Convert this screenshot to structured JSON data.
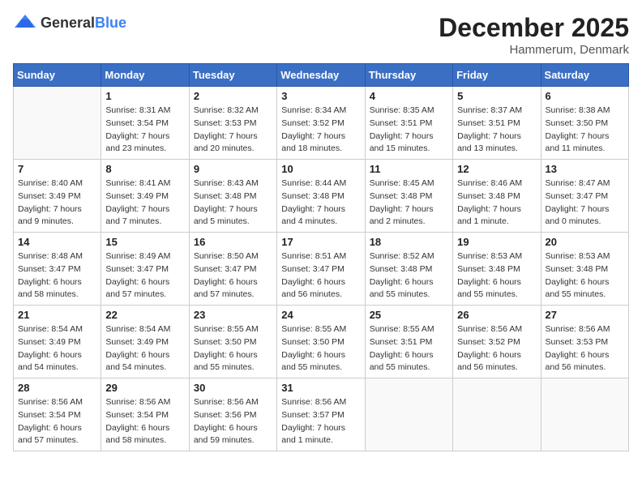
{
  "header": {
    "logo_general": "General",
    "logo_blue": "Blue",
    "month_year": "December 2025",
    "location": "Hammerum, Denmark"
  },
  "weekdays": [
    "Sunday",
    "Monday",
    "Tuesday",
    "Wednesday",
    "Thursday",
    "Friday",
    "Saturday"
  ],
  "weeks": [
    [
      {
        "day": "",
        "info": ""
      },
      {
        "day": "1",
        "info": "Sunrise: 8:31 AM\nSunset: 3:54 PM\nDaylight: 7 hours\nand 23 minutes."
      },
      {
        "day": "2",
        "info": "Sunrise: 8:32 AM\nSunset: 3:53 PM\nDaylight: 7 hours\nand 20 minutes."
      },
      {
        "day": "3",
        "info": "Sunrise: 8:34 AM\nSunset: 3:52 PM\nDaylight: 7 hours\nand 18 minutes."
      },
      {
        "day": "4",
        "info": "Sunrise: 8:35 AM\nSunset: 3:51 PM\nDaylight: 7 hours\nand 15 minutes."
      },
      {
        "day": "5",
        "info": "Sunrise: 8:37 AM\nSunset: 3:51 PM\nDaylight: 7 hours\nand 13 minutes."
      },
      {
        "day": "6",
        "info": "Sunrise: 8:38 AM\nSunset: 3:50 PM\nDaylight: 7 hours\nand 11 minutes."
      }
    ],
    [
      {
        "day": "7",
        "info": "Sunrise: 8:40 AM\nSunset: 3:49 PM\nDaylight: 7 hours\nand 9 minutes."
      },
      {
        "day": "8",
        "info": "Sunrise: 8:41 AM\nSunset: 3:49 PM\nDaylight: 7 hours\nand 7 minutes."
      },
      {
        "day": "9",
        "info": "Sunrise: 8:43 AM\nSunset: 3:48 PM\nDaylight: 7 hours\nand 5 minutes."
      },
      {
        "day": "10",
        "info": "Sunrise: 8:44 AM\nSunset: 3:48 PM\nDaylight: 7 hours\nand 4 minutes."
      },
      {
        "day": "11",
        "info": "Sunrise: 8:45 AM\nSunset: 3:48 PM\nDaylight: 7 hours\nand 2 minutes."
      },
      {
        "day": "12",
        "info": "Sunrise: 8:46 AM\nSunset: 3:48 PM\nDaylight: 7 hours\nand 1 minute."
      },
      {
        "day": "13",
        "info": "Sunrise: 8:47 AM\nSunset: 3:47 PM\nDaylight: 7 hours\nand 0 minutes."
      }
    ],
    [
      {
        "day": "14",
        "info": "Sunrise: 8:48 AM\nSunset: 3:47 PM\nDaylight: 6 hours\nand 58 minutes."
      },
      {
        "day": "15",
        "info": "Sunrise: 8:49 AM\nSunset: 3:47 PM\nDaylight: 6 hours\nand 57 minutes."
      },
      {
        "day": "16",
        "info": "Sunrise: 8:50 AM\nSunset: 3:47 PM\nDaylight: 6 hours\nand 57 minutes."
      },
      {
        "day": "17",
        "info": "Sunrise: 8:51 AM\nSunset: 3:47 PM\nDaylight: 6 hours\nand 56 minutes."
      },
      {
        "day": "18",
        "info": "Sunrise: 8:52 AM\nSunset: 3:48 PM\nDaylight: 6 hours\nand 55 minutes."
      },
      {
        "day": "19",
        "info": "Sunrise: 8:53 AM\nSunset: 3:48 PM\nDaylight: 6 hours\nand 55 minutes."
      },
      {
        "day": "20",
        "info": "Sunrise: 8:53 AM\nSunset: 3:48 PM\nDaylight: 6 hours\nand 55 minutes."
      }
    ],
    [
      {
        "day": "21",
        "info": "Sunrise: 8:54 AM\nSunset: 3:49 PM\nDaylight: 6 hours\nand 54 minutes."
      },
      {
        "day": "22",
        "info": "Sunrise: 8:54 AM\nSunset: 3:49 PM\nDaylight: 6 hours\nand 54 minutes."
      },
      {
        "day": "23",
        "info": "Sunrise: 8:55 AM\nSunset: 3:50 PM\nDaylight: 6 hours\nand 55 minutes."
      },
      {
        "day": "24",
        "info": "Sunrise: 8:55 AM\nSunset: 3:50 PM\nDaylight: 6 hours\nand 55 minutes."
      },
      {
        "day": "25",
        "info": "Sunrise: 8:55 AM\nSunset: 3:51 PM\nDaylight: 6 hours\nand 55 minutes."
      },
      {
        "day": "26",
        "info": "Sunrise: 8:56 AM\nSunset: 3:52 PM\nDaylight: 6 hours\nand 56 minutes."
      },
      {
        "day": "27",
        "info": "Sunrise: 8:56 AM\nSunset: 3:53 PM\nDaylight: 6 hours\nand 56 minutes."
      }
    ],
    [
      {
        "day": "28",
        "info": "Sunrise: 8:56 AM\nSunset: 3:54 PM\nDaylight: 6 hours\nand 57 minutes."
      },
      {
        "day": "29",
        "info": "Sunrise: 8:56 AM\nSunset: 3:54 PM\nDaylight: 6 hours\nand 58 minutes."
      },
      {
        "day": "30",
        "info": "Sunrise: 8:56 AM\nSunset: 3:56 PM\nDaylight: 6 hours\nand 59 minutes."
      },
      {
        "day": "31",
        "info": "Sunrise: 8:56 AM\nSunset: 3:57 PM\nDaylight: 7 hours\nand 1 minute."
      },
      {
        "day": "",
        "info": ""
      },
      {
        "day": "",
        "info": ""
      },
      {
        "day": "",
        "info": ""
      }
    ]
  ]
}
